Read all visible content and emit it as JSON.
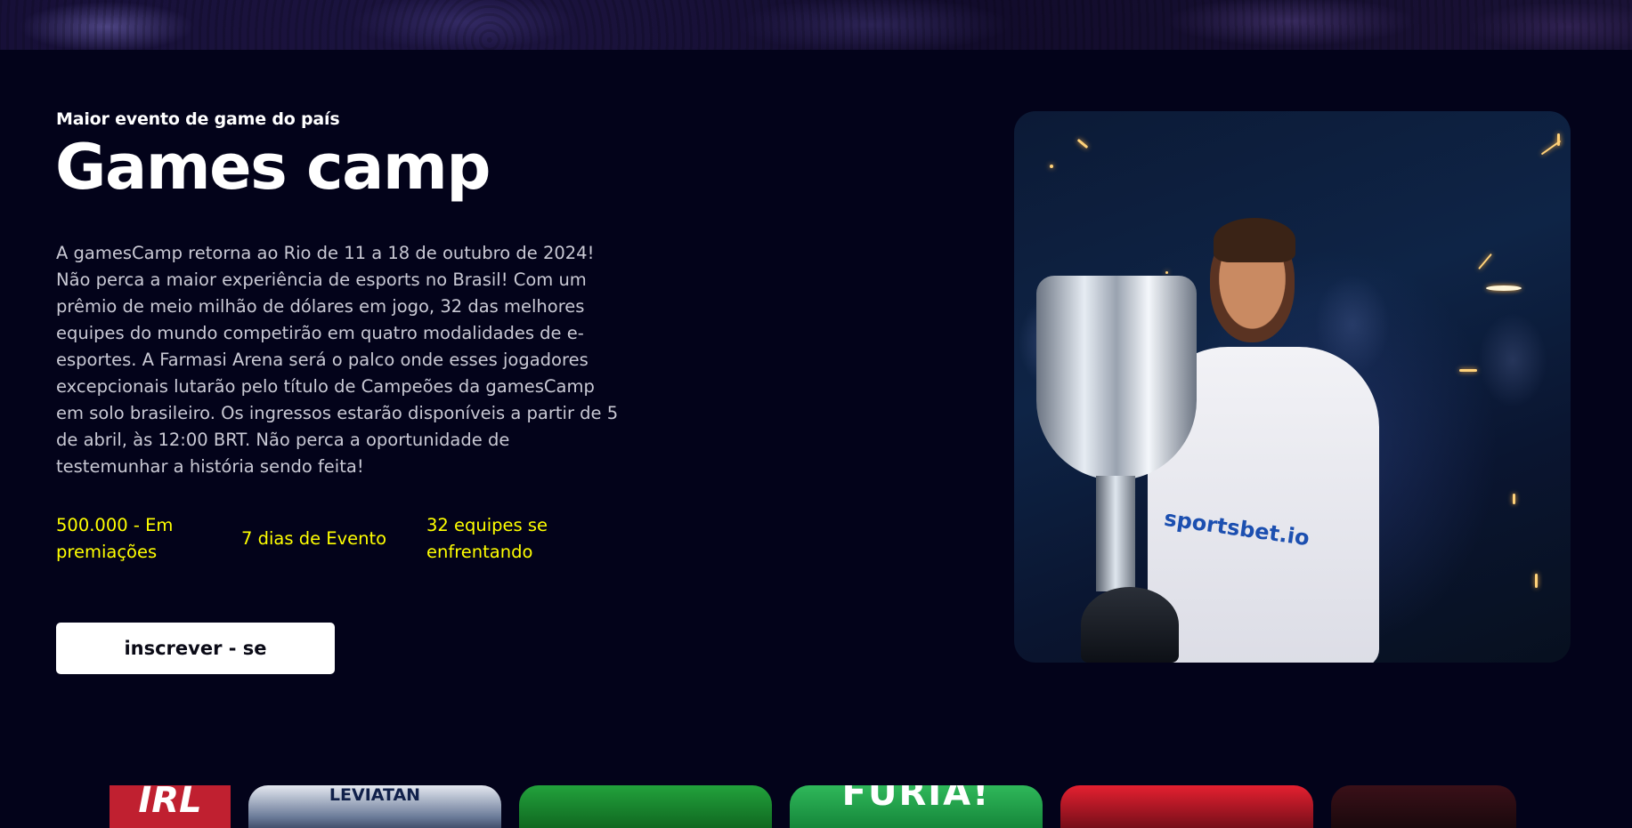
{
  "hero": {
    "eyebrow": "Maior evento de game do país",
    "title": "Games camp",
    "description": "A gamesCamp retorna ao Rio de 11 a 18 de outubro de 2024! Não perca a maior experiência de esports no Brasil! Com um prêmio de meio milhão de dólares em jogo, 32 das melhores equipes do mundo competirão em quatro modalidades de e-esportes. A Farmasi Arena será o palco onde esses jogadores excepcionais lutarão pelo título de Campeões da gamesCamp em solo brasileiro. Os ingressos estarão disponíveis a partir de 5 de abril, às 12:00 BRT. Não perca a oportunidade de testemunhar a história sendo feita!",
    "stats": [
      {
        "label": "500.000 - Em premiações"
      },
      {
        "label": "7 dias de Evento"
      },
      {
        "label": "32 equipes se enfrentando"
      }
    ],
    "cta_label": "inscrever - se"
  },
  "photo": {
    "shirt_text": "sportsbet.io"
  },
  "carousel": {
    "cards": [
      {
        "label": "IRL",
        "color": "#ffffff"
      },
      {
        "label": "LEVIATAN",
        "color": "#2b3a5a"
      },
      {
        "label": "",
        "color": "#1e7a2a"
      },
      {
        "label": "FURIA!",
        "color": "#2aa24a"
      },
      {
        "label": "",
        "color": "#8b1020"
      },
      {
        "label": "",
        "color": "#1a0c12"
      }
    ]
  },
  "colors": {
    "background": "#03031a",
    "accent_yellow": "#ffff00",
    "text_muted": "#c9c9d4",
    "button_bg": "#ffffff"
  }
}
